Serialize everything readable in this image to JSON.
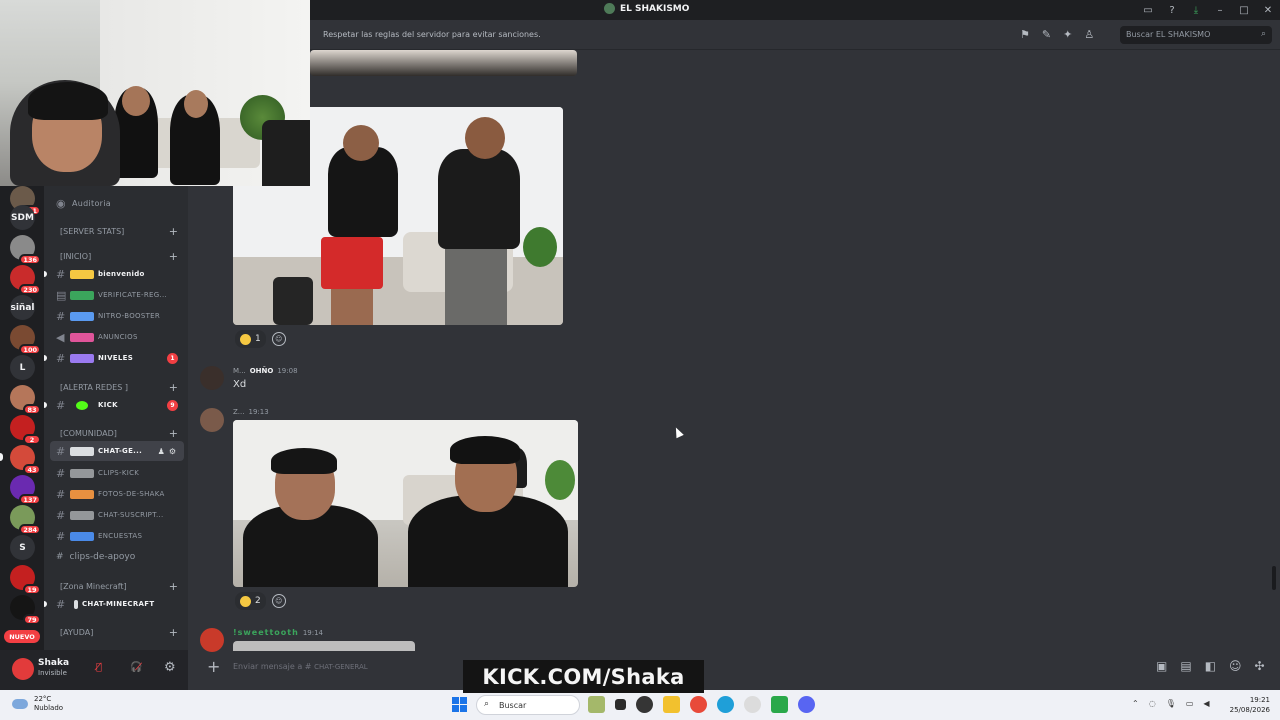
{
  "window": {
    "title": "EL SHAKISMO"
  },
  "topbar": {
    "topic": "Respetar las reglas del servidor para evitar sanciones.",
    "search_placeholder": "Buscar EL SHAKISMO"
  },
  "rail": {
    "servers": [
      {
        "label": "",
        "badge": "161",
        "color": "#6b5a4a"
      },
      {
        "label": "SDM",
        "badge": "",
        "color": ""
      },
      {
        "label": "",
        "badge": "136",
        "color": "#8a8a8a"
      },
      {
        "label": "",
        "badge": "230",
        "color": "#c92b2b"
      },
      {
        "label": "siñal",
        "badge": "",
        "color": ""
      },
      {
        "label": "",
        "badge": "100",
        "color": "#7a4a32"
      },
      {
        "label": "L",
        "badge": "",
        "color": ""
      },
      {
        "label": "",
        "badge": "83",
        "color": "#b5765a"
      },
      {
        "label": "",
        "badge": "2",
        "color": "#c42020"
      },
      {
        "label": "",
        "badge": "43",
        "color": "#d44a3a"
      },
      {
        "label": "",
        "badge": "137",
        "color": "#6a2ab0"
      },
      {
        "label": "",
        "badge": "284",
        "color": "#7a9a5a"
      },
      {
        "label": "S",
        "badge": "",
        "color": ""
      },
      {
        "label": "",
        "badge": "19",
        "color": "#c42020"
      },
      {
        "label": "",
        "badge": "79",
        "color": "#151515"
      }
    ],
    "nuevo_label": "NUEVO"
  },
  "sidebar": {
    "auditoria": "Auditoria",
    "categories": {
      "server_stats": "[SERVER STATS]",
      "inicio": "[INICIO]",
      "alerta": "[ALERTA REDES ]",
      "comunidad": "[COMUNIDAD]",
      "minecraft": "[Zona Minecraft]",
      "ayuda": "[AYUDA]"
    },
    "channels": [
      {
        "name": "bienvenido",
        "emoji_color": "#f5c842",
        "unread": true,
        "count": ""
      },
      {
        "name": "verificate-reg...",
        "emoji_color": "#3ba55c",
        "unread": false,
        "count": ""
      },
      {
        "name": "nitro-booster",
        "emoji_color": "#5a9af0",
        "unread": false,
        "count": ""
      },
      {
        "name": "anuncios",
        "emoji_color": "#e0559a",
        "unread": false,
        "count": ""
      },
      {
        "name": "niveles",
        "emoji_color": "#9a7af0",
        "unread": true,
        "count": "1"
      },
      {
        "name": "kick",
        "emoji_color": "#53fc18",
        "unread": true,
        "count": "9"
      },
      {
        "name": "chat-ge...",
        "emoji_color": "#dbdee1",
        "unread": true,
        "count": ""
      },
      {
        "name": "clips-kick",
        "emoji_color": "#dbdee1",
        "unread": false,
        "count": ""
      },
      {
        "name": "fotos-de-shaka",
        "emoji_color": "#e89040",
        "unread": false,
        "count": ""
      },
      {
        "name": "chat-suscript...",
        "emoji_color": "#dbdee1",
        "unread": false,
        "count": ""
      },
      {
        "name": "encuestas",
        "emoji_color": "#4a8ae8",
        "unread": false,
        "count": ""
      },
      {
        "name": "chat-minecraft",
        "emoji_color": "#dbdee1",
        "unread": true,
        "count": ""
      }
    ],
    "clips_apoyo": "clips-de-apoyo"
  },
  "user": {
    "name": "Shaka",
    "status": "Invisible"
  },
  "messages": [
    {
      "author": "M...",
      "tag": "OHÑO",
      "time": "19:08",
      "text": "Xd"
    },
    {
      "author": "Z...",
      "time": "19:13"
    },
    {
      "author": "!sweettooth",
      "time": "19:14"
    }
  ],
  "reactions": [
    {
      "count": "1"
    },
    {
      "count": "2"
    }
  ],
  "composer": {
    "placeholder": "Enviar mensaje a #",
    "channel_hint": "CHAT-GENERAL"
  },
  "overlay": {
    "kick": "KICK.COM/Shaka"
  },
  "taskbar": {
    "temp": "22°C",
    "weather": "Nublado",
    "search": "Buscar",
    "time": "19:21",
    "date": "25/08/2026"
  }
}
